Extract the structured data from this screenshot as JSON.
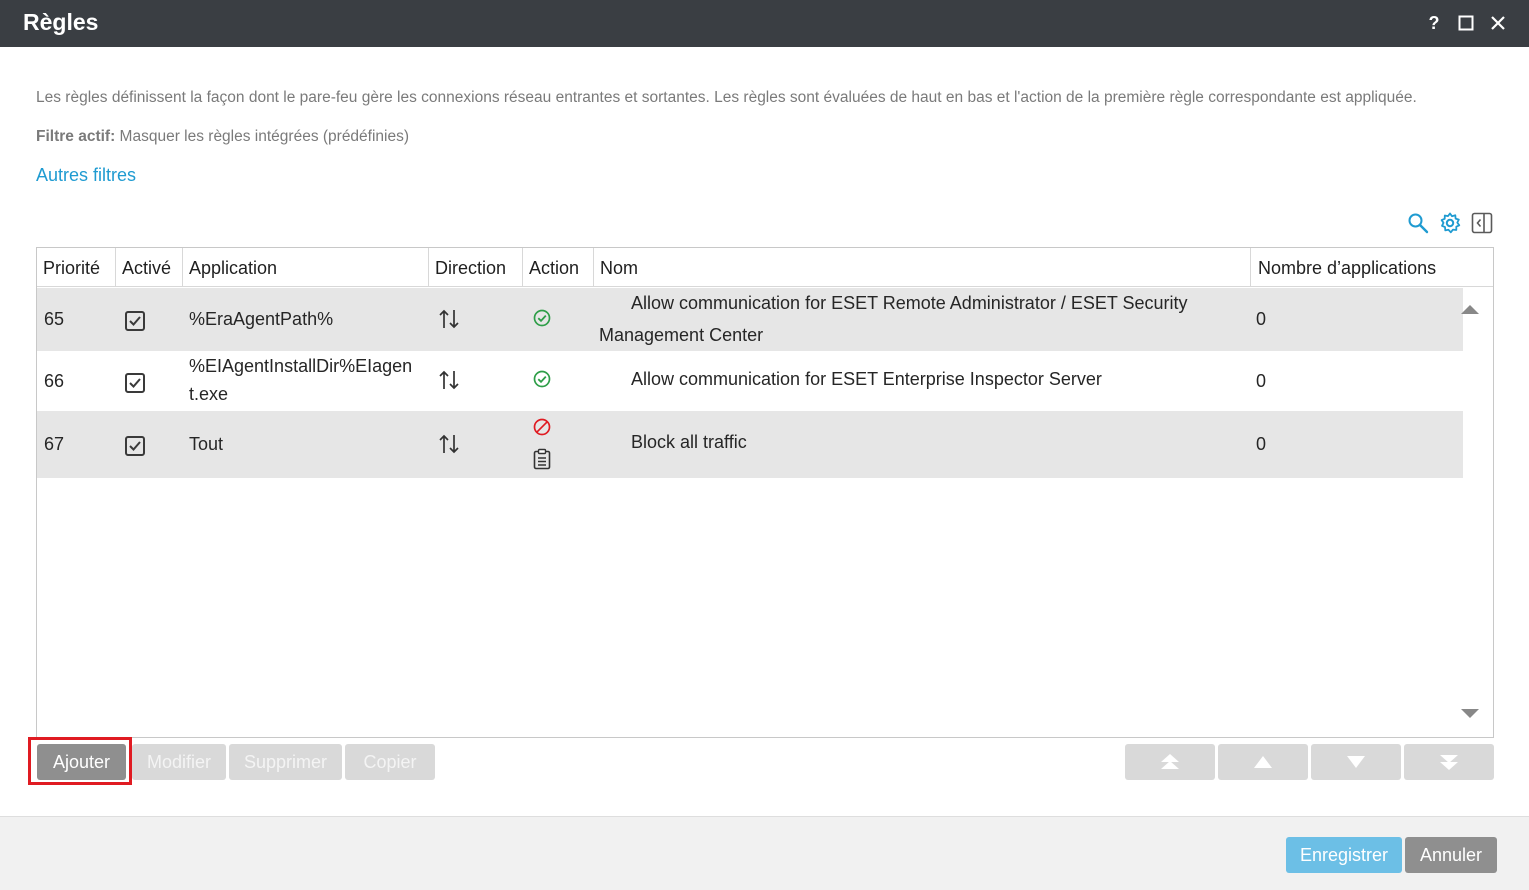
{
  "window": {
    "title": "Règles",
    "help_label": "?"
  },
  "description": "Les règles définissent la façon dont le pare-feu gère les connexions réseau entrantes et sortantes. Les règles sont évaluées de haut en bas et l'action de la première règle correspondante est appliquée.",
  "filter": {
    "label": "Filtre actif:",
    "value": "Masquer les règles intégrées (prédéfinies)"
  },
  "other_filters_link": "Autres filtres",
  "table": {
    "headers": {
      "priority": "Priorité",
      "enabled": "Activé",
      "application": "Application",
      "direction": "Direction",
      "action": "Action",
      "name": "Nom",
      "app_count": "Nombre d’applications"
    },
    "rows": [
      {
        "priority": "65",
        "enabled": true,
        "application": "%EraAgentPath%",
        "direction_icon": "bidirectional-arrows-icon",
        "action_icon": "allow-check-icon",
        "name_line1": "Allow communication for ESET Remote Administrator / ESET Security",
        "name_line2": "Management Center",
        "app_count": "0"
      },
      {
        "priority": "66",
        "enabled": true,
        "application_line1": "%EIAgentInstallDir%EIagen",
        "application_line2": "t.exe",
        "direction_icon": "bidirectional-arrows-icon",
        "action_icon": "allow-check-icon",
        "name": "Allow communication for ESET Enterprise Inspector Server",
        "app_count": "0"
      },
      {
        "priority": "67",
        "enabled": true,
        "application": "Tout",
        "direction_icon": "bidirectional-arrows-icon",
        "action_icon": "block-icon",
        "action_icon2": "log-clipboard-icon",
        "name": "Block all traffic",
        "app_count": "0"
      }
    ]
  },
  "buttons": {
    "add": "Ajouter",
    "edit": "Modifier",
    "delete": "Supprimer",
    "copy": "Copier"
  },
  "footer": {
    "save": "Enregistrer",
    "cancel": "Annuler"
  },
  "colors": {
    "titlebar": "#3a3e43",
    "link": "#1f9bd1",
    "save_button": "#6cbfe6",
    "cancel_button": "#8f8f8f",
    "allow": "#2e9e48",
    "block": "#e01b22",
    "highlight": "#e01b22"
  }
}
